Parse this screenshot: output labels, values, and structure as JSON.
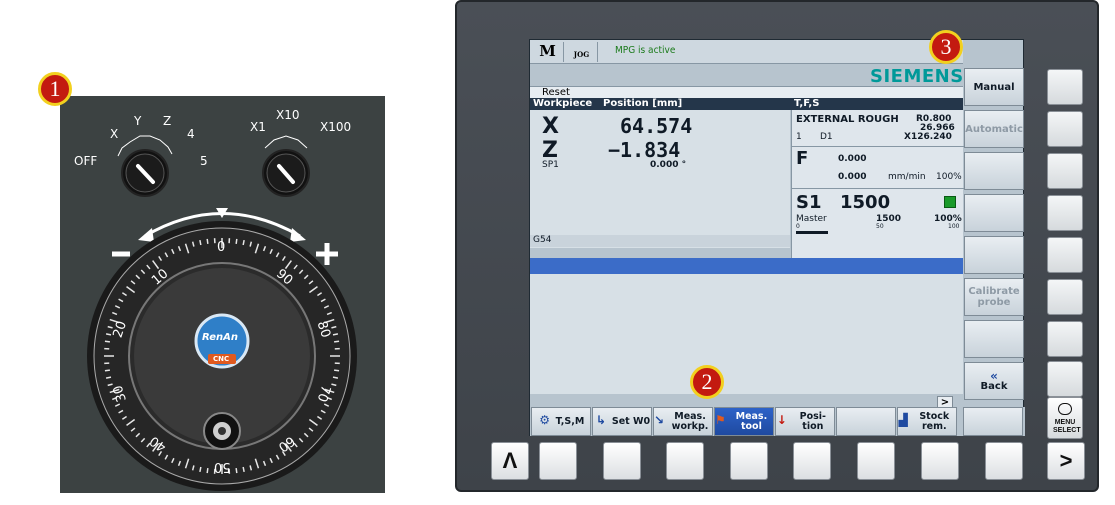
{
  "badges": [
    "1",
    "2",
    "3"
  ],
  "mpg": {
    "axis_labels": [
      "OFF",
      "X",
      "Y",
      "Z",
      "4",
      "5"
    ],
    "mult_labels": [
      "X1",
      "X10",
      "X100"
    ],
    "minus": "−",
    "plus": "+",
    "dial_numbers": [
      "0",
      "10",
      "20",
      "30",
      "40",
      "50",
      "60",
      "70",
      "80",
      "90"
    ],
    "logo_text": "RenAn",
    "logo_sub": "CNC",
    "colors": {
      "panel": "#3c4242",
      "logo": "#2f7fc8"
    }
  },
  "controller": {
    "header": {
      "mode_icon": "M",
      "jog_icon": "JOG",
      "status": "MPG is active",
      "brand": "SIEMENS"
    },
    "reset_label": "Reset",
    "columns": {
      "workpiece": "Workpiece",
      "position": "Position [mm]",
      "tfs": "T,F,S"
    },
    "axes": [
      {
        "name": "X",
        "value": "64.574"
      },
      {
        "name": "Z",
        "value": "−1.834"
      }
    ],
    "spindle_label": "SP1",
    "spindle_value": "0.000 °",
    "frame": "G54",
    "tool": {
      "name": "EXTERNAL ROUGH",
      "r_value": "R0.800",
      "z_value": "26.966",
      "x_value": "X126.240",
      "number": "1",
      "d_label": "D1"
    },
    "feed": {
      "label": "F",
      "value1": "0.000",
      "value2": "0.000",
      "unit": "mm/min",
      "percent": "100%"
    },
    "spindle": {
      "label": "S1",
      "speed": "1500",
      "master": "Master",
      "master_speed": "1500",
      "percent": "100%",
      "scale": [
        "0",
        "50",
        "100"
      ]
    },
    "vertical_softkeys": [
      "Manual",
      "Automatic",
      "",
      "",
      "",
      "Calibrate probe",
      "",
      "Back"
    ],
    "horizontal_softkeys": [
      "T,S,M",
      "Set W0",
      "Meas. workp.",
      "Meas. tool",
      "Posi- tion",
      "",
      "Stock rem.",
      ""
    ],
    "etc_arrow": ">",
    "bottom_keys": [
      "Λ",
      "",
      "",
      "",
      "",
      "",
      "",
      "",
      "",
      ">"
    ],
    "menu_select": "MENU SELECT"
  }
}
